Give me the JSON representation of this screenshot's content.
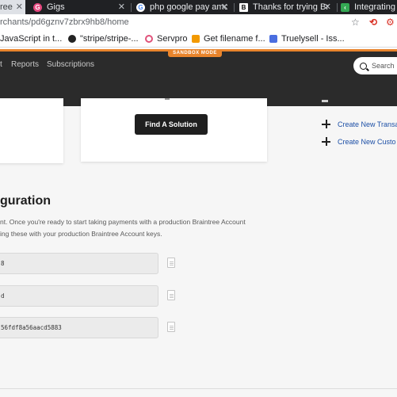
{
  "browser": {
    "tabs": [
      {
        "label": "ree",
        "active": true,
        "favicon": "braintree-icon"
      },
      {
        "label": "Gigs",
        "active": false,
        "favicon": "gigs-icon"
      },
      {
        "label": "php google pay amo",
        "active": false,
        "favicon": "google-icon"
      },
      {
        "label": "Thanks for trying Br",
        "active": false,
        "favicon": "braintree-b-icon"
      },
      {
        "label": "Integrating ",
        "active": false,
        "favicon": "code-icon"
      }
    ],
    "url": "rchants/pd6gznv7zbrx9hb8/home",
    "bookmarks": [
      {
        "label": "JavaScript in t...",
        "icon": "page-icon"
      },
      {
        "label": "\"stripe/stripe-...",
        "icon": "github-icon"
      },
      {
        "label": "Servpro",
        "icon": "servpro-icon"
      },
      {
        "label": "Get filename f...",
        "icon": "bookmark-icon"
      },
      {
        "label": "Truelysell - Iss...",
        "icon": "docs-icon"
      }
    ]
  },
  "header": {
    "sandbox_label": "SANDBOX MODE",
    "nav": [
      {
        "label": "t"
      },
      {
        "label": "Reports"
      },
      {
        "label": "Subscriptions"
      }
    ],
    "search_placeholder": "Search"
  },
  "cards": {
    "find_solution_label": "Find A Solution"
  },
  "actions": [
    {
      "label": "Create New Transa"
    },
    {
      "label": "Create New Custo"
    }
  ],
  "configuration": {
    "title": "guration",
    "description_line1": "nt. Once you're ready to start taking payments with a production Braintree Account",
    "description_line2": "ing these with your production Braintree Account keys.",
    "fields": [
      {
        "value": "8"
      },
      {
        "value": "d"
      },
      {
        "value": "56fdf8a56aacd5883"
      }
    ]
  },
  "colors": {
    "sandbox_accent": "#e8842c",
    "header_bg": "#2b2b2b",
    "link": "#1c4fa6"
  }
}
